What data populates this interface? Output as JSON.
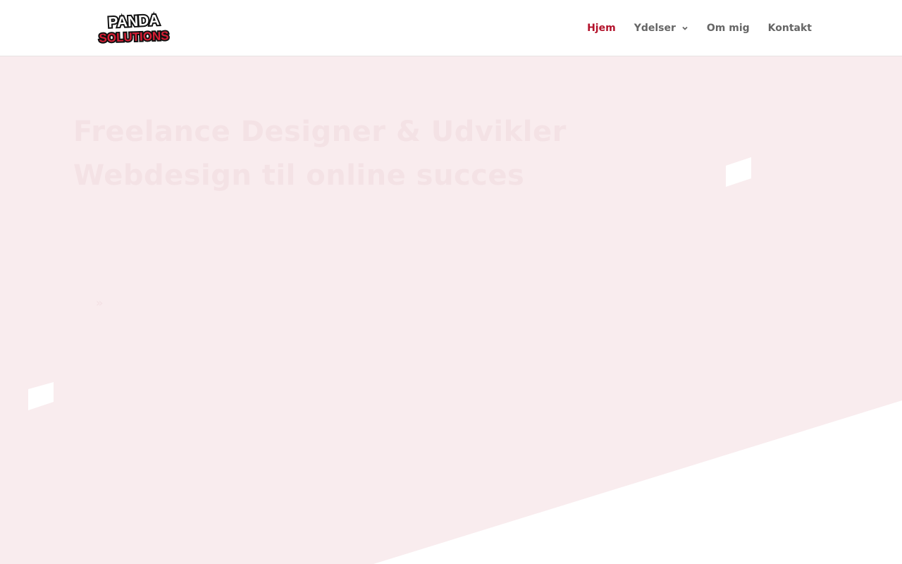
{
  "header": {
    "logo": {
      "line1": "PANDA",
      "line2": "SOLUTIONS"
    },
    "nav": [
      {
        "label": "Hjem",
        "active": true
      },
      {
        "label": "Ydelser",
        "has_dropdown": true
      },
      {
        "label": "Om mig"
      },
      {
        "label": "Kontakt"
      }
    ]
  },
  "hero": {
    "title_line1": "Freelance Designer & Udvikler",
    "title_line2": "Webdesign til online succes",
    "mark": "»"
  },
  "colors": {
    "accent": "#b3122b",
    "nav_text": "#666666",
    "hero_background": "#f9ecee",
    "white": "#ffffff"
  }
}
